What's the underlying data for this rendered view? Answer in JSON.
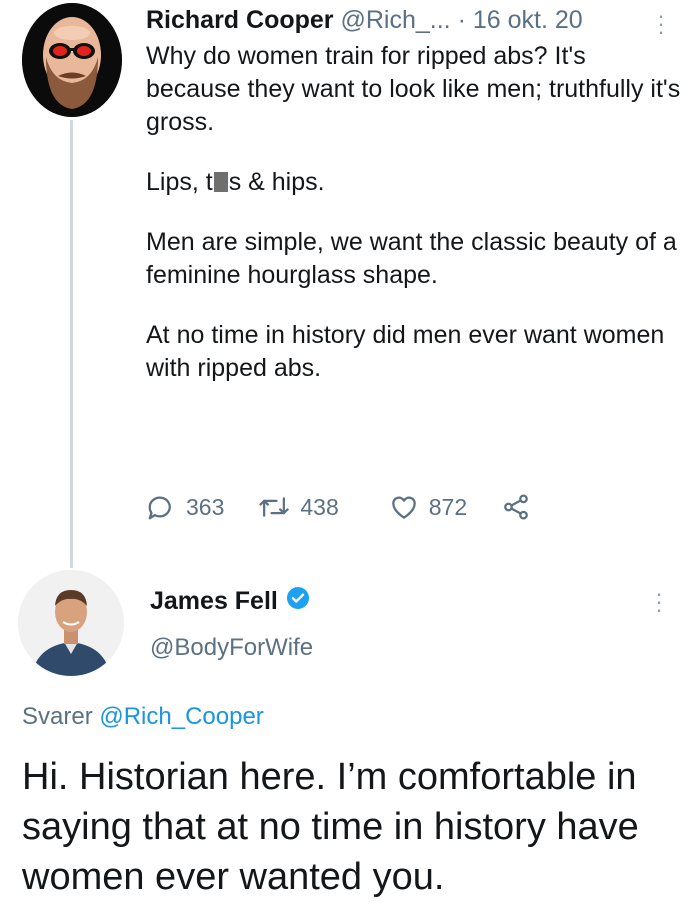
{
  "tweet": {
    "author_name": "Richard Cooper",
    "author_handle": "@Rich_...",
    "separator": "·",
    "date": "16 okt. 20",
    "paragraphs": {
      "p1": "Why do women train for ripped abs? It's because they want to look like men; truthfully it's gross.",
      "p2_before": "Lips, t",
      "p2_after": "s & hips.",
      "p3": "Men are simple, we want the classic beauty of a feminine hourglass shape.",
      "p4": "At no time in history did men ever want women with ripped abs."
    },
    "stats": {
      "replies": "363",
      "retweets": "438",
      "likes": "872"
    },
    "icons": [
      "reply-icon",
      "retweet-icon",
      "like-icon",
      "share-icon",
      "more-icon"
    ]
  },
  "reply": {
    "author_name": "James Fell",
    "author_handle": "@BodyForWife",
    "verified": true,
    "replying_label": "Svarer",
    "replying_mention": "@Rich_Cooper",
    "text": "Hi. Historian here. I’m comfortable in saying that at no time in history have women ever wanted you."
  },
  "colors": {
    "text": "#14171a",
    "muted": "#5b7083",
    "link": "#1b95e0",
    "verified": "#1da1f2",
    "thread_line": "#cfd9de"
  }
}
